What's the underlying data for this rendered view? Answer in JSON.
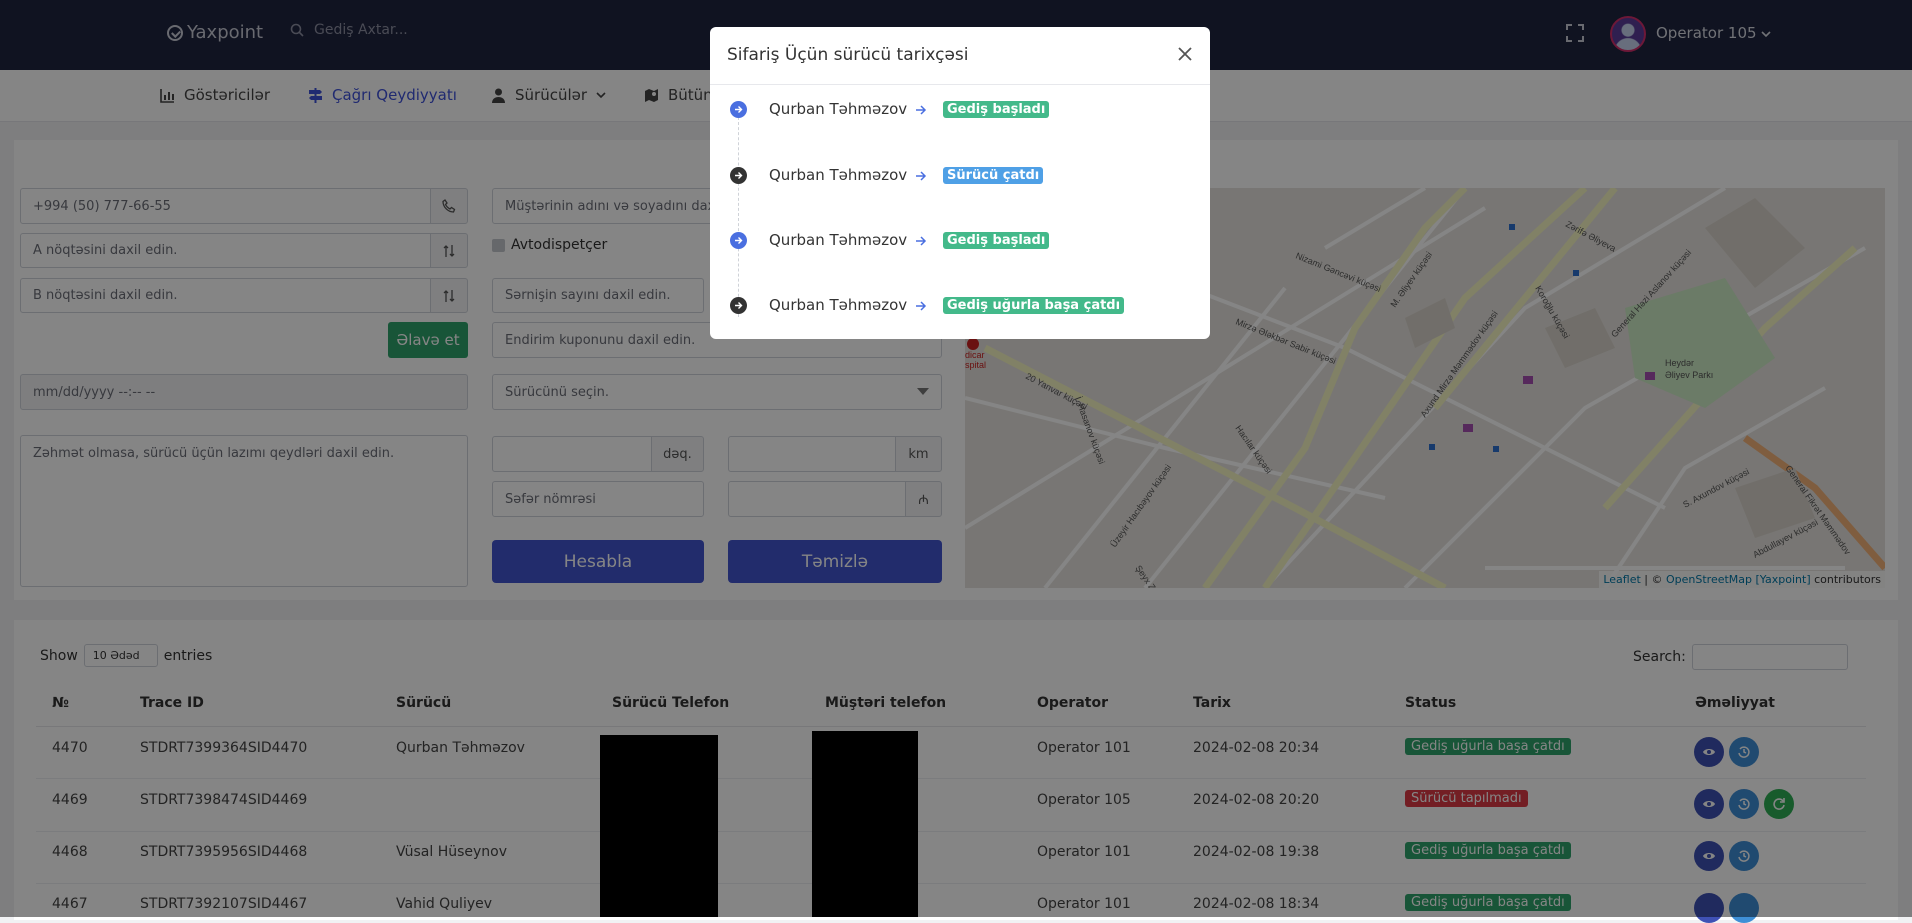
{
  "topbar": {
    "logo": "Yaxpoint",
    "search_placeholder": "Gediş Axtar...",
    "operator": "Operator 105"
  },
  "nav": [
    {
      "label": "Göstəricilər",
      "icon": "chart-icon"
    },
    {
      "label": "Çağrı Qeydiyyatı",
      "icon": "signpost-icon"
    },
    {
      "label": "Sürücülər",
      "icon": "user-icon"
    },
    {
      "label": "Bütün",
      "icon": "map-icon"
    }
  ],
  "form": {
    "phone_value": "+994 (50) 777-66-55",
    "customer_placeholder": "Müştərinin adını və soyadını daxil edin.",
    "point_a_placeholder": "A nöqtəsini daxil edin.",
    "point_b_placeholder": "B nöqtəsini daxil edin.",
    "autodispatcher_label": "Avtodispetçer",
    "passenger_count_placeholder": "Sərnişin sayını daxil edin.",
    "add_button": "Əlavə et",
    "coupon_placeholder": "Endirim kuponunu daxil edin.",
    "datetime_placeholder": "mm/dd/yyyy --:-- --",
    "driver_select": "Sürücünü seçin.",
    "notes_placeholder": "Zəhmət olmasa, sürücü üçün lazımı qeydləri daxil edin.",
    "minutes_unit": "dəq.",
    "km_unit": "km",
    "trip_number_placeholder": "Səfər nömrəsi",
    "currency_unit": "₼",
    "calculate_button": "Hesabla",
    "clear_button": "Təmizlə"
  },
  "map": {
    "attribution_leaflet": "Leaflet",
    "attribution_sep": " | © ",
    "attribution_osm": "OpenStreetMap [Yaxpoint]",
    "attribution_tail": " contributors",
    "labels": [
      "Zərifə Əliyeva",
      "Nizami Gəncəvi küçəsi",
      "M. Əliyev küçəsi",
      "Mirzə Ələkbər Sabir küçəsi",
      "20 Yanvar küçəsi",
      "Heydər Əliyev Parkı",
      "General Fikrət Məmmədov",
      "Axund Mirzə Məmmədov küçəsi",
      "General Həzi Aslanov küçəsi",
      "Hacılar küçəsi",
      "Üzeyir Hacıbəyov küçəsi",
      "Şeyx Zahid küçəsi",
      "S. Axundov küçəsi",
      "Abdullayev küçəsi",
      "Koroğlu küçəsi",
      "İ. Hasanov küçəsi",
      "dicar spital"
    ]
  },
  "table": {
    "show_label": "Show",
    "length_value": "10 Ədəd",
    "entries_label": "entries",
    "search_label": "Search:",
    "columns": [
      "№",
      "Trace ID",
      "Sürücü",
      "Sürücü Telefon",
      "Müştəri telefon",
      "Operator",
      "Tarix",
      "Status",
      "Əməliyyat"
    ],
    "rows": [
      {
        "no": "4470",
        "trace": "STDRT7399364SID4470",
        "driver": "Qurban Təhməzov",
        "operator": "Operator 101",
        "date": "2024-02-08 20:34",
        "status": "Gediş uğurla başa çatdı",
        "status_color": "#2fa36b"
      },
      {
        "no": "4469",
        "trace": "STDRT7398474SID4469",
        "driver": "",
        "operator": "Operator 105",
        "date": "2024-02-08 20:20",
        "status": "Sürücü tapılmadı",
        "status_color": "#dc3b46"
      },
      {
        "no": "4468",
        "trace": "STDRT7395956SID4468",
        "driver": "Vüsal Hüseynov",
        "operator": "Operator 101",
        "date": "2024-02-08 19:38",
        "status": "Gediş uğurla başa çatdı",
        "status_color": "#2fa36b"
      },
      {
        "no": "4467",
        "trace": "STDRT7392107SID4467",
        "driver": "Vahid Quliyev",
        "operator": "Operator 101",
        "date": "2024-02-08 18:34",
        "status": "Gediş uğurla başa çatdı",
        "status_color": "#2fa36b"
      }
    ]
  },
  "modal": {
    "title": "Sifariş Üçün sürücü tarixçəsi",
    "history": [
      {
        "driver": "Qurban Təhməzov",
        "status": "Gediş başladı",
        "status_color": "#43b98a",
        "dot_color": "#4a6fe0"
      },
      {
        "driver": "Qurban Təhməzov",
        "status": "Sürücü çatdı",
        "status_color": "#4fa0e6",
        "dot_color": "#333333"
      },
      {
        "driver": "Qurban Təhməzov",
        "status": "Gediş başladı",
        "status_color": "#43b98a",
        "dot_color": "#4a6fe0"
      },
      {
        "driver": "Qurban Təhməzov",
        "status": "Gediş uğurla başa çatdı",
        "status_color": "#43b98a",
        "dot_color": "#333333"
      }
    ]
  }
}
